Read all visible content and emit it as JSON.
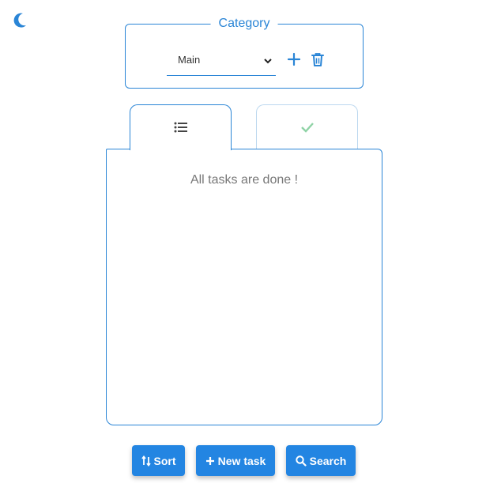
{
  "theme_toggle": {
    "icon": "moon-icon",
    "color": "#2a85d6"
  },
  "category": {
    "legend": "Category",
    "selected": "Main",
    "add_icon": "plus-icon",
    "delete_icon": "trash-icon"
  },
  "tabs": [
    {
      "icon": "list-icon",
      "active": true
    },
    {
      "icon": "check-icon",
      "active": false
    }
  ],
  "tasks": {
    "empty_message": "All tasks are done !"
  },
  "actions": {
    "sort_label": "Sort",
    "new_task_label": "New task",
    "search_label": "Search"
  },
  "colors": {
    "accent": "#2385e2",
    "border": "#2a85d6",
    "check": "#8fd3a6"
  }
}
